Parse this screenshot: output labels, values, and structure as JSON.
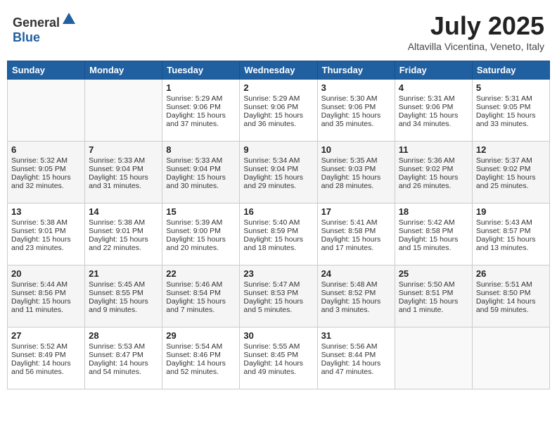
{
  "header": {
    "logo_general": "General",
    "logo_blue": "Blue",
    "title": "July 2025",
    "subtitle": "Altavilla Vicentina, Veneto, Italy"
  },
  "columns": [
    "Sunday",
    "Monday",
    "Tuesday",
    "Wednesday",
    "Thursday",
    "Friday",
    "Saturday"
  ],
  "weeks": [
    [
      {
        "day": "",
        "text": ""
      },
      {
        "day": "",
        "text": ""
      },
      {
        "day": "1",
        "text": "Sunrise: 5:29 AM\nSunset: 9:06 PM\nDaylight: 15 hours and 37 minutes."
      },
      {
        "day": "2",
        "text": "Sunrise: 5:29 AM\nSunset: 9:06 PM\nDaylight: 15 hours and 36 minutes."
      },
      {
        "day": "3",
        "text": "Sunrise: 5:30 AM\nSunset: 9:06 PM\nDaylight: 15 hours and 35 minutes."
      },
      {
        "day": "4",
        "text": "Sunrise: 5:31 AM\nSunset: 9:06 PM\nDaylight: 15 hours and 34 minutes."
      },
      {
        "day": "5",
        "text": "Sunrise: 5:31 AM\nSunset: 9:05 PM\nDaylight: 15 hours and 33 minutes."
      }
    ],
    [
      {
        "day": "6",
        "text": "Sunrise: 5:32 AM\nSunset: 9:05 PM\nDaylight: 15 hours and 32 minutes."
      },
      {
        "day": "7",
        "text": "Sunrise: 5:33 AM\nSunset: 9:04 PM\nDaylight: 15 hours and 31 minutes."
      },
      {
        "day": "8",
        "text": "Sunrise: 5:33 AM\nSunset: 9:04 PM\nDaylight: 15 hours and 30 minutes."
      },
      {
        "day": "9",
        "text": "Sunrise: 5:34 AM\nSunset: 9:04 PM\nDaylight: 15 hours and 29 minutes."
      },
      {
        "day": "10",
        "text": "Sunrise: 5:35 AM\nSunset: 9:03 PM\nDaylight: 15 hours and 28 minutes."
      },
      {
        "day": "11",
        "text": "Sunrise: 5:36 AM\nSunset: 9:02 PM\nDaylight: 15 hours and 26 minutes."
      },
      {
        "day": "12",
        "text": "Sunrise: 5:37 AM\nSunset: 9:02 PM\nDaylight: 15 hours and 25 minutes."
      }
    ],
    [
      {
        "day": "13",
        "text": "Sunrise: 5:38 AM\nSunset: 9:01 PM\nDaylight: 15 hours and 23 minutes."
      },
      {
        "day": "14",
        "text": "Sunrise: 5:38 AM\nSunset: 9:01 PM\nDaylight: 15 hours and 22 minutes."
      },
      {
        "day": "15",
        "text": "Sunrise: 5:39 AM\nSunset: 9:00 PM\nDaylight: 15 hours and 20 minutes."
      },
      {
        "day": "16",
        "text": "Sunrise: 5:40 AM\nSunset: 8:59 PM\nDaylight: 15 hours and 18 minutes."
      },
      {
        "day": "17",
        "text": "Sunrise: 5:41 AM\nSunset: 8:58 PM\nDaylight: 15 hours and 17 minutes."
      },
      {
        "day": "18",
        "text": "Sunrise: 5:42 AM\nSunset: 8:58 PM\nDaylight: 15 hours and 15 minutes."
      },
      {
        "day": "19",
        "text": "Sunrise: 5:43 AM\nSunset: 8:57 PM\nDaylight: 15 hours and 13 minutes."
      }
    ],
    [
      {
        "day": "20",
        "text": "Sunrise: 5:44 AM\nSunset: 8:56 PM\nDaylight: 15 hours and 11 minutes."
      },
      {
        "day": "21",
        "text": "Sunrise: 5:45 AM\nSunset: 8:55 PM\nDaylight: 15 hours and 9 minutes."
      },
      {
        "day": "22",
        "text": "Sunrise: 5:46 AM\nSunset: 8:54 PM\nDaylight: 15 hours and 7 minutes."
      },
      {
        "day": "23",
        "text": "Sunrise: 5:47 AM\nSunset: 8:53 PM\nDaylight: 15 hours and 5 minutes."
      },
      {
        "day": "24",
        "text": "Sunrise: 5:48 AM\nSunset: 8:52 PM\nDaylight: 15 hours and 3 minutes."
      },
      {
        "day": "25",
        "text": "Sunrise: 5:50 AM\nSunset: 8:51 PM\nDaylight: 15 hours and 1 minute."
      },
      {
        "day": "26",
        "text": "Sunrise: 5:51 AM\nSunset: 8:50 PM\nDaylight: 14 hours and 59 minutes."
      }
    ],
    [
      {
        "day": "27",
        "text": "Sunrise: 5:52 AM\nSunset: 8:49 PM\nDaylight: 14 hours and 56 minutes."
      },
      {
        "day": "28",
        "text": "Sunrise: 5:53 AM\nSunset: 8:47 PM\nDaylight: 14 hours and 54 minutes."
      },
      {
        "day": "29",
        "text": "Sunrise: 5:54 AM\nSunset: 8:46 PM\nDaylight: 14 hours and 52 minutes."
      },
      {
        "day": "30",
        "text": "Sunrise: 5:55 AM\nSunset: 8:45 PM\nDaylight: 14 hours and 49 minutes."
      },
      {
        "day": "31",
        "text": "Sunrise: 5:56 AM\nSunset: 8:44 PM\nDaylight: 14 hours and 47 minutes."
      },
      {
        "day": "",
        "text": ""
      },
      {
        "day": "",
        "text": ""
      }
    ]
  ]
}
